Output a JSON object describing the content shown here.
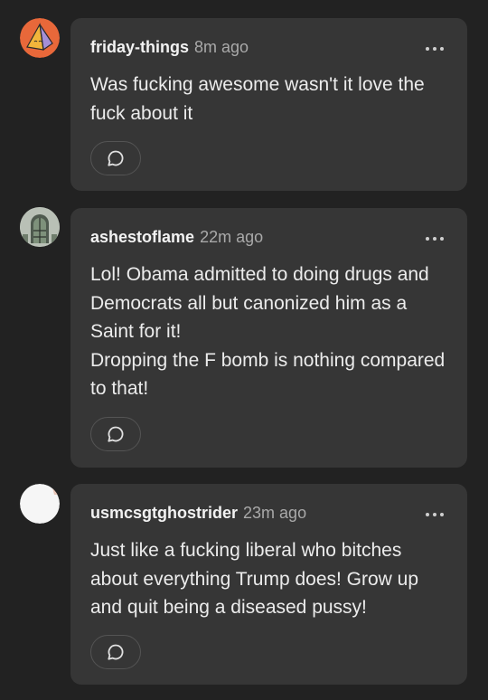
{
  "comments": [
    {
      "username": "friday-things",
      "time": "8m ago",
      "text": "Was fucking awesome wasn't it love the fuck about it",
      "avatar": "orange-pyramid-avatar"
    },
    {
      "username": "ashestoflame",
      "time": "22m ago",
      "text": "Lol! Obama admitted to doing drugs and Democrats all but canonized him as a Saint for it!\nDropping the F bomb is nothing compared to that!",
      "avatar": "stained-glass-window-avatar"
    },
    {
      "username": "usmcsgtghostrider",
      "time": "23m ago",
      "text": "Just like a fucking liberal who bitches about everything Trump does! Grow up and quit being a  diseased pussy!",
      "avatar": "white-blank-avatar"
    }
  ],
  "icons": {
    "more": "more-options-icon",
    "reply": "reply-bubble-icon"
  },
  "colors": {
    "background": "#222222",
    "card": "#363636",
    "username": "#f2f2f2",
    "timestamp": "#a9a9a9"
  }
}
